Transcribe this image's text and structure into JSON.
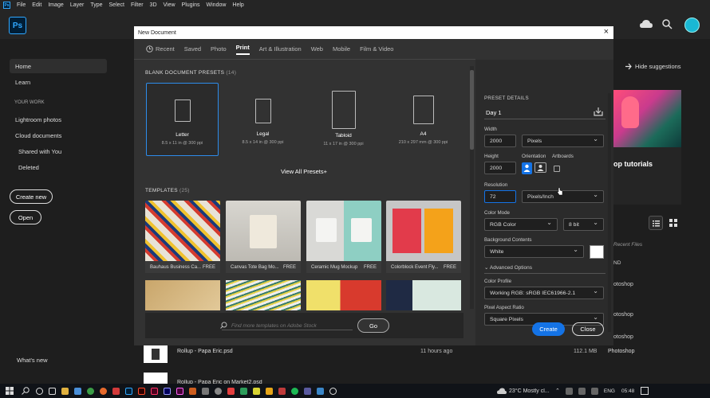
{
  "menubar": {
    "items": [
      "File",
      "Edit",
      "Image",
      "Layer",
      "Type",
      "Select",
      "Filter",
      "3D",
      "View",
      "Plugins",
      "Window",
      "Help"
    ]
  },
  "app": {
    "logo": "Ps"
  },
  "nav": {
    "home": "Home",
    "learn": "Learn",
    "your_work": "YOUR WORK",
    "lightroom": "Lightroom photos",
    "cloud": "Cloud documents",
    "shared": "Shared with You",
    "deleted": "Deleted",
    "create_new": "Create new",
    "open": "Open",
    "whats_new": "What's new"
  },
  "home_bg": {
    "hide_suggestions": "Hide suggestions",
    "tutorials": "op tutorials",
    "recent_files": "Recent Files",
    "col_nd": "ND",
    "rows": [
      {
        "name": "Rollup - Papa Eric.psd",
        "time": "11 hours ago",
        "size": "112.1 MB",
        "kind": "Photoshop"
      },
      {
        "name": "Rollup - Papa Eric on Market2.psd",
        "time": "",
        "size": "",
        "kind": ""
      }
    ],
    "kind_labels": [
      "otoshop",
      "otoshop",
      "otoshop",
      "otoshop"
    ]
  },
  "dialog": {
    "title": "New Document",
    "tabs": [
      "Recent",
      "Saved",
      "Photo",
      "Print",
      "Art & Illustration",
      "Web",
      "Mobile",
      "Film & Video"
    ],
    "selected_tab": "Print",
    "blank_title": "BLANK DOCUMENT PRESETS",
    "blank_count": "(14)",
    "presets": [
      {
        "name": "Letter",
        "size": "8.5 x 11 in @ 300 ppi"
      },
      {
        "name": "Legal",
        "size": "8.5 x 14 in @ 300 ppi"
      },
      {
        "name": "Tabloid",
        "size": "11 x 17 in @ 300 ppi"
      },
      {
        "name": "A4",
        "size": "210 x 297 mm @ 300 ppi"
      }
    ],
    "view_all": "View All Presets+",
    "templates_title": "TEMPLATES",
    "templates_count": "(25)",
    "templates": [
      {
        "name": "Bauhaus Business Ca...",
        "tag": "FREE"
      },
      {
        "name": "Canvas Tote Bag Mo...",
        "tag": "FREE"
      },
      {
        "name": "Ceramic Mug Mockup",
        "tag": "FREE"
      },
      {
        "name": "Colorblock Event Fly...",
        "tag": "FREE"
      }
    ],
    "search_placeholder": "Find more templates on Adobe Stock",
    "go": "Go",
    "details": {
      "header": "PRESET DETAILS",
      "doc_name": "Day 1",
      "width_label": "Width",
      "width": "2000",
      "width_unit": "Pixels",
      "height_label": "Height",
      "height": "2000",
      "orientation_label": "Orientation",
      "artboards_label": "Artboards",
      "resolution_label": "Resolution",
      "resolution": "72",
      "resolution_unit": "Pixels/Inch",
      "color_mode_label": "Color Mode",
      "color_mode": "RGB Color",
      "bit_depth": "8 bit",
      "bg_label": "Background Contents",
      "bg": "White",
      "advanced": "Advanced Options",
      "profile_label": "Color Profile",
      "profile": "Working RGB: sRGB IEC61966-2.1",
      "pixel_ratio_label": "Pixel Aspect Ratio",
      "pixel_ratio": "Square Pixels"
    },
    "create": "Create",
    "close": "Close"
  },
  "taskbar": {
    "weather": "23°C  Mostly cl...",
    "lang": "ENG",
    "time": "05:48"
  },
  "colors": {
    "accent": "#1473e6",
    "ps_blue": "#31a8ff",
    "selected_border": "#2d8ceb"
  }
}
